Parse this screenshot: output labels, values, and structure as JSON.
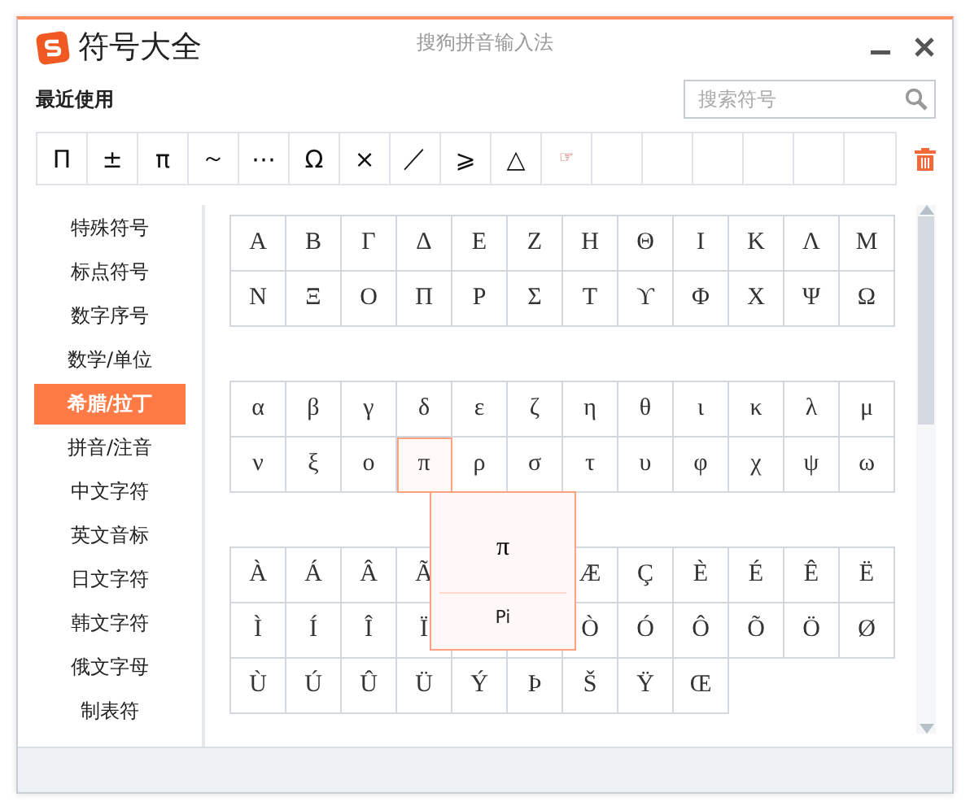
{
  "window": {
    "title": "符号大全",
    "subtitle": "搜狗拼音输入法"
  },
  "recent": {
    "label": "最近使用",
    "symbols": [
      "Π",
      "±",
      "π",
      "～",
      "⋯",
      "Ω",
      "×",
      "／",
      "⩾",
      "△",
      "☞"
    ]
  },
  "search": {
    "placeholder": "搜索符号"
  },
  "sidebar": {
    "items": [
      {
        "label": "特殊符号",
        "selected": false
      },
      {
        "label": "标点符号",
        "selected": false
      },
      {
        "label": "数字序号",
        "selected": false
      },
      {
        "label": "数学/单位",
        "selected": false
      },
      {
        "label": "希腊/拉丁",
        "selected": true
      },
      {
        "label": "拼音/注音",
        "selected": false
      },
      {
        "label": "中文字符",
        "selected": false
      },
      {
        "label": "英文音标",
        "selected": false
      },
      {
        "label": "日文字符",
        "selected": false
      },
      {
        "label": "韩文字符",
        "selected": false
      },
      {
        "label": "俄文字母",
        "selected": false
      },
      {
        "label": "制表符",
        "selected": false
      }
    ]
  },
  "grids": [
    {
      "rows": [
        [
          {
            "char": "Α",
            "selected": false
          },
          {
            "char": "Β",
            "selected": false
          },
          {
            "char": "Γ",
            "selected": false
          },
          {
            "char": "Δ",
            "selected": false
          },
          {
            "char": "Ε",
            "selected": false
          },
          {
            "char": "Ζ",
            "selected": false
          },
          {
            "char": "Η",
            "selected": false
          },
          {
            "char": "Θ",
            "selected": false
          },
          {
            "char": "Ι",
            "selected": false
          },
          {
            "char": "Κ",
            "selected": false
          },
          {
            "char": "Λ",
            "selected": false
          },
          {
            "char": "Μ",
            "selected": false
          }
        ],
        [
          {
            "char": "Ν",
            "selected": false
          },
          {
            "char": "Ξ",
            "selected": false
          },
          {
            "char": "Ο",
            "selected": false
          },
          {
            "char": "Π",
            "selected": false
          },
          {
            "char": "Ρ",
            "selected": false
          },
          {
            "char": "Σ",
            "selected": false
          },
          {
            "char": "Τ",
            "selected": false
          },
          {
            "char": "ϒ",
            "selected": false
          },
          {
            "char": "Φ",
            "selected": false
          },
          {
            "char": "Χ",
            "selected": false
          },
          {
            "char": "Ψ",
            "selected": false
          },
          {
            "char": "Ω",
            "selected": false
          }
        ]
      ]
    },
    {
      "rows": [
        [
          {
            "char": "α",
            "selected": false
          },
          {
            "char": "β",
            "selected": false
          },
          {
            "char": "γ",
            "selected": false
          },
          {
            "char": "δ",
            "selected": false
          },
          {
            "char": "ε",
            "selected": false
          },
          {
            "char": "ζ",
            "selected": false
          },
          {
            "char": "η",
            "selected": false
          },
          {
            "char": "θ",
            "selected": false
          },
          {
            "char": "ι",
            "selected": false
          },
          {
            "char": "κ",
            "selected": false
          },
          {
            "char": "λ",
            "selected": false
          },
          {
            "char": "μ",
            "selected": false
          }
        ],
        [
          {
            "char": "ν",
            "selected": false
          },
          {
            "char": "ξ",
            "selected": false
          },
          {
            "char": "ο",
            "selected": false
          },
          {
            "char": "π",
            "selected": true
          },
          {
            "char": "ρ",
            "selected": false
          },
          {
            "char": "σ",
            "selected": false
          },
          {
            "char": "τ",
            "selected": false
          },
          {
            "char": "υ",
            "selected": false
          },
          {
            "char": "φ",
            "selected": false
          },
          {
            "char": "χ",
            "selected": false
          },
          {
            "char": "ψ",
            "selected": false
          },
          {
            "char": "ω",
            "selected": false
          }
        ]
      ]
    },
    {
      "rows": [
        [
          {
            "char": "À",
            "selected": false
          },
          {
            "char": "Á",
            "selected": false
          },
          {
            "char": "Â",
            "selected": false
          },
          {
            "char": "Ã",
            "selected": false
          },
          null,
          null,
          {
            "char": "Æ",
            "selected": false
          },
          {
            "char": "Ç",
            "selected": false
          },
          {
            "char": "È",
            "selected": false
          },
          {
            "char": "É",
            "selected": false
          },
          {
            "char": "Ê",
            "selected": false
          },
          {
            "char": "Ë",
            "selected": false
          }
        ],
        [
          {
            "char": "Ì",
            "selected": false
          },
          {
            "char": "Í",
            "selected": false
          },
          {
            "char": "Î",
            "selected": false
          },
          {
            "char": "Ï",
            "selected": false
          },
          null,
          null,
          {
            "char": "Ò",
            "selected": false
          },
          {
            "char": "Ó",
            "selected": false
          },
          {
            "char": "Ô",
            "selected": false
          },
          {
            "char": "Õ",
            "selected": false
          },
          {
            "char": "Ö",
            "selected": false
          },
          {
            "char": "Ø",
            "selected": false
          }
        ],
        [
          {
            "char": "Ù",
            "selected": false
          },
          {
            "char": "Ú",
            "selected": false
          },
          {
            "char": "Û",
            "selected": false
          },
          {
            "char": "Ü",
            "selected": false
          },
          {
            "char": "Ý",
            "selected": false
          },
          {
            "char": "Þ",
            "selected": false
          },
          {
            "char": "Š",
            "selected": false
          },
          {
            "char": "Ÿ",
            "selected": false
          },
          {
            "char": "Œ",
            "selected": false
          }
        ]
      ]
    }
  ],
  "tooltip": {
    "symbol": "π",
    "name": "Pi"
  }
}
